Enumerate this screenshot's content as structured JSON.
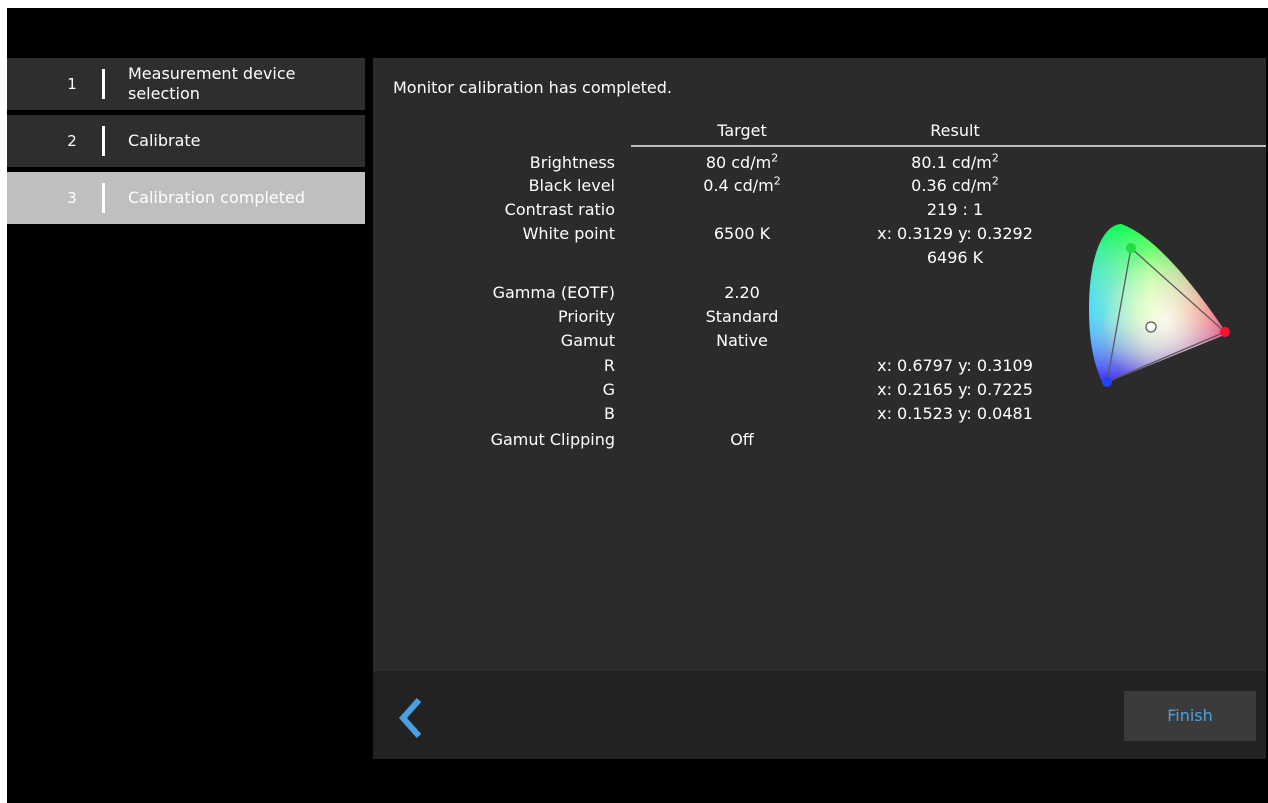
{
  "sidebar": {
    "steps": [
      {
        "num": "1",
        "label": "Measurement device selection"
      },
      {
        "num": "2",
        "label": "Calibrate"
      },
      {
        "num": "3",
        "label": "Calibration completed"
      }
    ]
  },
  "main": {
    "title": "Monitor calibration has completed.",
    "col_target": "Target",
    "col_result": "Result",
    "rows": {
      "brightness": {
        "label": "Brightness",
        "target": "80 cd/m",
        "result": "80.1 cd/m",
        "unit_exp": "2"
      },
      "black_level": {
        "label": "Black level",
        "target": "0.4 cd/m",
        "result": "0.36 cd/m",
        "unit_exp": "2"
      },
      "contrast": {
        "label": "Contrast ratio",
        "target": "",
        "result": "219 : 1"
      },
      "white_point": {
        "label": "White point",
        "target": "6500 K",
        "result": "x: 0.3129  y: 0.3292",
        "result2": "6496 K"
      },
      "gamma": {
        "label": "Gamma (EOTF)",
        "target": "2.20"
      },
      "priority": {
        "label": "Priority",
        "target": "Standard"
      },
      "gamut": {
        "label": "Gamut",
        "target": "Native"
      },
      "r": {
        "label": "R",
        "result": "x: 0.6797  y: 0.3109"
      },
      "g": {
        "label": "G",
        "result": "x: 0.2165  y: 0.7225"
      },
      "b": {
        "label": "B",
        "result": "x: 0.1523  y: 0.0481"
      },
      "clipping": {
        "label": "Gamut Clipping",
        "target": "Off"
      }
    }
  },
  "footer": {
    "finish_label": "Finish"
  },
  "colors": {
    "accent": "#4a9fe0",
    "panel": "#2b2b2b",
    "sidebar_step": "#2e2e2e",
    "sidebar_active": "#bfbfbf"
  },
  "icons": {
    "back": "chevron-left-icon",
    "gamut": "cie-gamut-diagram-icon"
  }
}
